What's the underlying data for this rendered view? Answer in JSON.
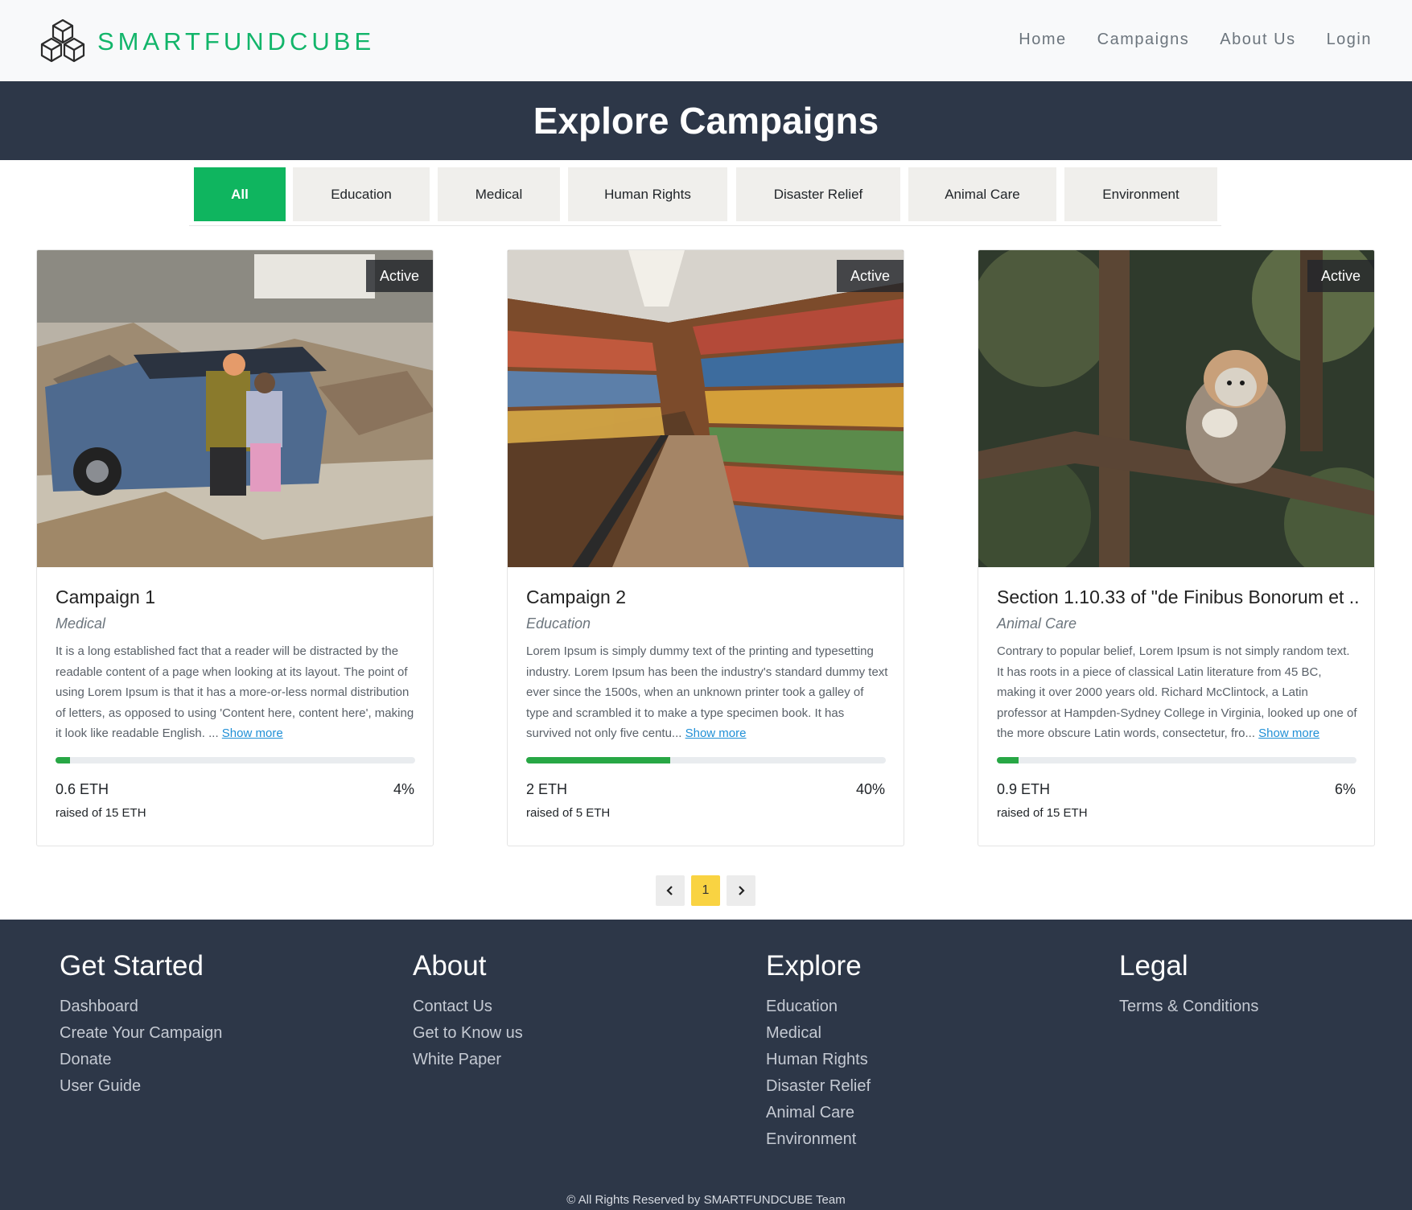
{
  "brand": {
    "name": "SMARTFUNDCUBE",
    "logo_icon": "hexagon-cubes-logo",
    "color": "#12b56a"
  },
  "nav": {
    "items": [
      "Home",
      "Campaigns",
      "About Us",
      "Login"
    ]
  },
  "hero": {
    "title": "Explore Campaigns"
  },
  "filters": {
    "active": "All",
    "active_color": "#0fb55f",
    "items": [
      "All",
      "Education",
      "Medical",
      "Human Rights",
      "Disaster Relief",
      "Animal Care",
      "Environment"
    ]
  },
  "campaigns": [
    {
      "status": "Active",
      "title": "Campaign 1",
      "category": "Medical",
      "image": "disaster-cleanup-photo",
      "description": "It is a long established fact that a reader will be distracted by the readable content of a page when looking at its layout. The point of using Lorem Ipsum is that it has a more-or-less normal distribution of letters, as opposed to using 'Content here, content here', making it look like readable English. ...",
      "show_more": "Show more",
      "progress_fraction": 0.04,
      "raised": "0.6 ETH",
      "percent": "4%",
      "goal": "raised of 15 ETH"
    },
    {
      "status": "Active",
      "title": "Campaign 2",
      "category": "Education",
      "image": "library-bookshelves-photo",
      "description": "Lorem Ipsum is simply dummy text of the printing and typesetting industry. Lorem Ipsum has been the industry's standard dummy text ever since the 1500s, when an unknown printer took a galley of type and scrambled it to make a type specimen book. It has survived not only five centu...",
      "show_more": "Show more",
      "progress_fraction": 0.4,
      "raised": "2 ETH",
      "percent": "40%",
      "goal": "raised of 5 ETH"
    },
    {
      "status": "Active",
      "title": "Section 1.10.33 of \"de Finibus Bonorum et ...",
      "category": "Animal Care",
      "image": "monkey-in-tree-photo",
      "description": "Contrary to popular belief, Lorem Ipsum is not simply random text. It has roots in a piece of classical Latin literature from 45 BC, making it over 2000 years old. Richard McClintock, a Latin professor at Hampden-Sydney College in Virginia, looked up one of the more obscure Latin words, consectetur, fro...",
      "show_more": "Show more",
      "progress_fraction": 0.06,
      "raised": "0.9 ETH",
      "percent": "6%",
      "goal": "raised of 15 ETH"
    }
  ],
  "pagination": {
    "prev_icon": "chevron-left-icon",
    "current": "1",
    "next_icon": "chevron-right-icon"
  },
  "footer": {
    "columns": [
      {
        "heading": "Get Started",
        "links": [
          "Dashboard",
          "Create Your Campaign",
          "Donate",
          "User Guide"
        ]
      },
      {
        "heading": "About",
        "links": [
          "Contact Us",
          "Get to Know us",
          "White Paper"
        ]
      },
      {
        "heading": "Explore",
        "links": [
          "Education",
          "Medical",
          "Human Rights",
          "Disaster Relief",
          "Animal Care",
          "Environment"
        ]
      },
      {
        "heading": "Legal",
        "links": [
          "Terms & Conditions"
        ]
      }
    ],
    "copyright": "© All Rights Reserved by SMARTFUNDCUBE Team"
  }
}
